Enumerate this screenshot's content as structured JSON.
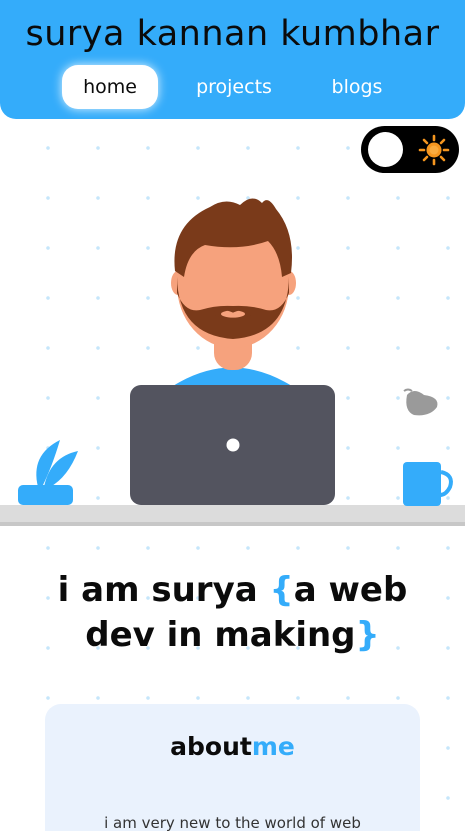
{
  "header": {
    "title": "surya kannan kumbhar",
    "nav": {
      "home": "home",
      "projects": "projects",
      "blogs": "blogs"
    }
  },
  "theme_toggle": {
    "icon": "sun-icon",
    "state": "light"
  },
  "hero": {
    "line1": "i am surya ",
    "brace_open": "{",
    "phrase1": "a web",
    "phrase2": "dev in making",
    "brace_close": "}"
  },
  "about": {
    "title_main": "about",
    "title_accent": "me",
    "text": "i am very new to the world of web"
  },
  "colors": {
    "accent": "#34acfa",
    "laptop": "#53545f",
    "card_bg": "#eaf2fd",
    "sun": "#f5961f"
  }
}
